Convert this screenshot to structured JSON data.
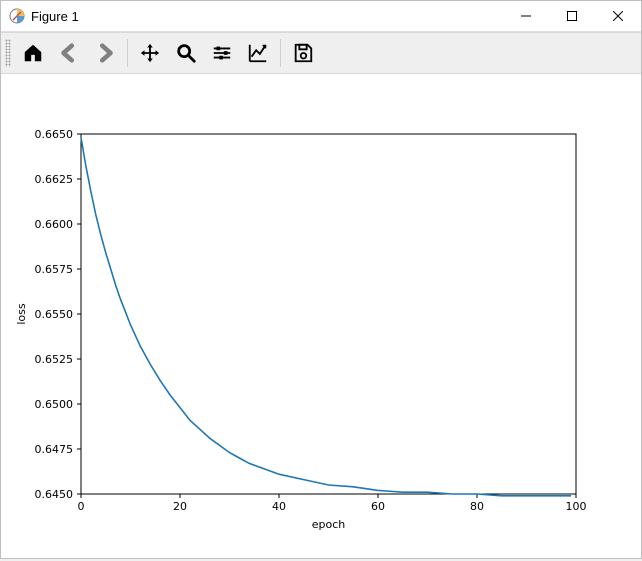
{
  "window": {
    "title": "Figure 1"
  },
  "toolbar": {
    "home": "Home",
    "back": "Back",
    "forward": "Forward",
    "pan": "Pan",
    "zoom": "Zoom",
    "subplots": "Configure subplots",
    "edit": "Edit axis",
    "save": "Save"
  },
  "chart_data": {
    "type": "line",
    "xlabel": "epoch",
    "ylabel": "loss",
    "xlim": [
      0,
      100
    ],
    "ylim": [
      0.645,
      0.665
    ],
    "xticks": [
      0,
      20,
      40,
      60,
      80,
      100
    ],
    "yticks": [
      0.645,
      0.6475,
      0.65,
      0.6525,
      0.655,
      0.6575,
      0.66,
      0.6625,
      0.665
    ],
    "xtick_labels": [
      "0",
      "20",
      "40",
      "60",
      "80",
      "100"
    ],
    "ytick_labels": [
      "0.6450",
      "0.6475",
      "0.6500",
      "0.6525",
      "0.6550",
      "0.6575",
      "0.6600",
      "0.6625",
      "0.6650"
    ],
    "series": [
      {
        "name": "loss",
        "color": "#1f77b4",
        "x": [
          0,
          1,
          2,
          3,
          4,
          5,
          6,
          7,
          8,
          9,
          10,
          12,
          14,
          16,
          18,
          20,
          22,
          24,
          26,
          28,
          30,
          32,
          34,
          36,
          38,
          40,
          45,
          50,
          55,
          60,
          65,
          70,
          75,
          80,
          85,
          90,
          95,
          99
        ],
        "y": [
          0.6648,
          0.6632,
          0.6618,
          0.6605,
          0.6594,
          0.6584,
          0.6575,
          0.6566,
          0.6558,
          0.6551,
          0.6544,
          0.6532,
          0.6522,
          0.6513,
          0.6505,
          0.6498,
          0.6491,
          0.6486,
          0.6481,
          0.6477,
          0.6473,
          0.647,
          0.6467,
          0.6465,
          0.6463,
          0.6461,
          0.6458,
          0.6455,
          0.6454,
          0.6452,
          0.6451,
          0.6451,
          0.645,
          0.645,
          0.6449,
          0.6449,
          0.6449,
          0.6449
        ]
      }
    ]
  }
}
